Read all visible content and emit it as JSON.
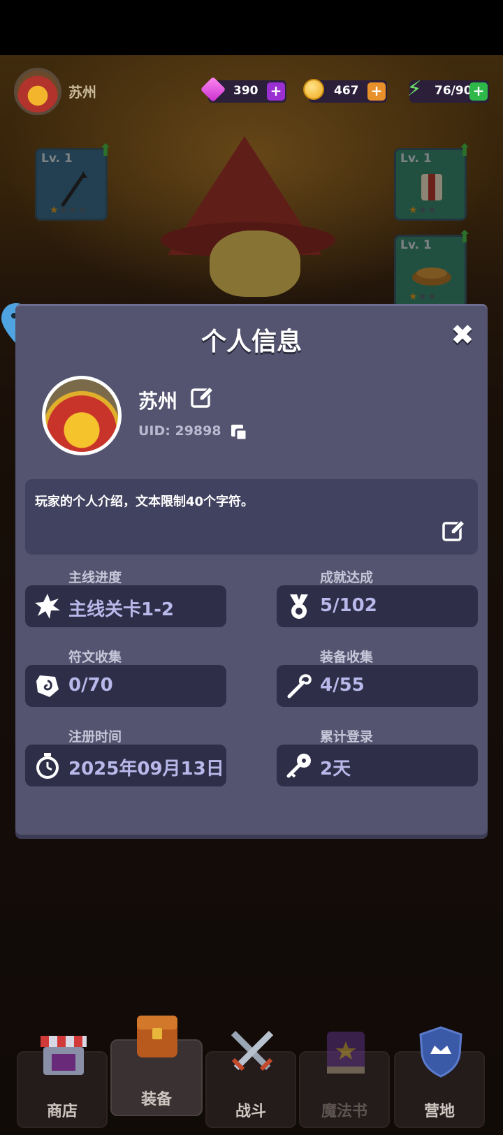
{
  "top_bar": {
    "player_name": "苏州",
    "currencies": [
      {
        "name": "gems",
        "value": "390",
        "icon": "gem-icon",
        "plus_color": "#9a2fd2"
      },
      {
        "name": "coins",
        "value": "467",
        "icon": "coin-icon",
        "plus_color": "#e8902a"
      },
      {
        "name": "energy",
        "value": "76/90",
        "icon": "lightning-icon",
        "plus_color": "#2fb84a"
      }
    ]
  },
  "equipment_slots": [
    {
      "level": "Lv. 1",
      "item": "spear-icon"
    },
    {
      "level": "Lv. 1",
      "item": "robe-icon"
    },
    {
      "level": "Lv. 1",
      "item": "shoes-icon"
    }
  ],
  "modal": {
    "title": "个人信息",
    "player_name": "苏州",
    "uid": "UID: 29898",
    "bio": "玩家的个人介绍，文本限制40个字符。",
    "stats": [
      {
        "label": "主线进度",
        "value": "主线关卡1-2",
        "icon": "burst-icon"
      },
      {
        "label": "成就达成",
        "value": "5/102",
        "icon": "medal-icon"
      },
      {
        "label": "符文收集",
        "value": "0/70",
        "icon": "rune-icon"
      },
      {
        "label": "装备收集",
        "value": "4/55",
        "icon": "staff-icon"
      },
      {
        "label": "注册时间",
        "value": "2025年09月13日",
        "icon": "stopwatch-icon"
      },
      {
        "label": "累计登录",
        "value": "2天",
        "icon": "key-icon"
      }
    ]
  },
  "bottom_nav": [
    {
      "label": "商店",
      "icon": "shop-icon"
    },
    {
      "label": "装备",
      "icon": "backpack-icon"
    },
    {
      "label": "战斗",
      "icon": "crossed-swords-icon"
    },
    {
      "label": "魔法书",
      "icon": "spellbook-icon"
    },
    {
      "label": "营地",
      "icon": "camp-shield-icon"
    }
  ]
}
